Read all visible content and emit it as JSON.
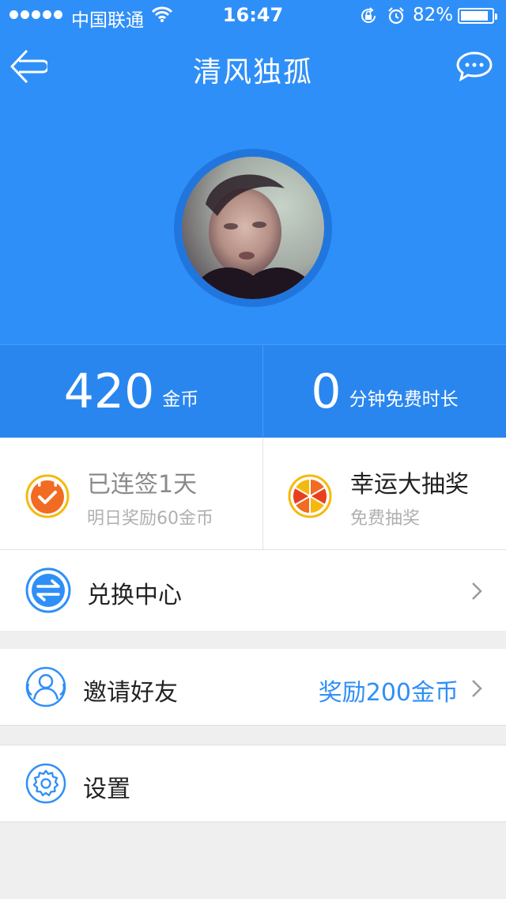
{
  "status_bar": {
    "carrier": "中国联通",
    "time": "16:47",
    "battery": "82%",
    "battery_level": 0.82,
    "signal_bars": 5
  },
  "nav": {
    "title": "清风独孤"
  },
  "stats": {
    "coins_value": "420",
    "coins_unit": "金币",
    "minutes_value": "0",
    "minutes_unit": "分钟免费时长"
  },
  "checkin": {
    "title": "已连签1天",
    "subtitle": "明日奖励60金币"
  },
  "lottery": {
    "title": "幸运大抽奖",
    "subtitle": "免费抽奖"
  },
  "exchange": {
    "label": "兑换中心"
  },
  "invite": {
    "label": "邀请好友",
    "reward": "奖励200金币"
  },
  "settings": {
    "label": "设置"
  },
  "colors": {
    "primary_blue": "#2f8ff8",
    "stats_blue": "#2a86ef",
    "background": "#efefef",
    "orange": "#f26b22",
    "yellow": "#f5b90e"
  },
  "icons": [
    "back-icon",
    "message-icon",
    "wifi-icon",
    "lock-rotation-icon",
    "alarm-icon",
    "checkin-calendar-icon",
    "lottery-wheel-icon",
    "exchange-icon",
    "invite-friends-icon",
    "settings-gear-icon",
    "chevron-right-icon"
  ]
}
